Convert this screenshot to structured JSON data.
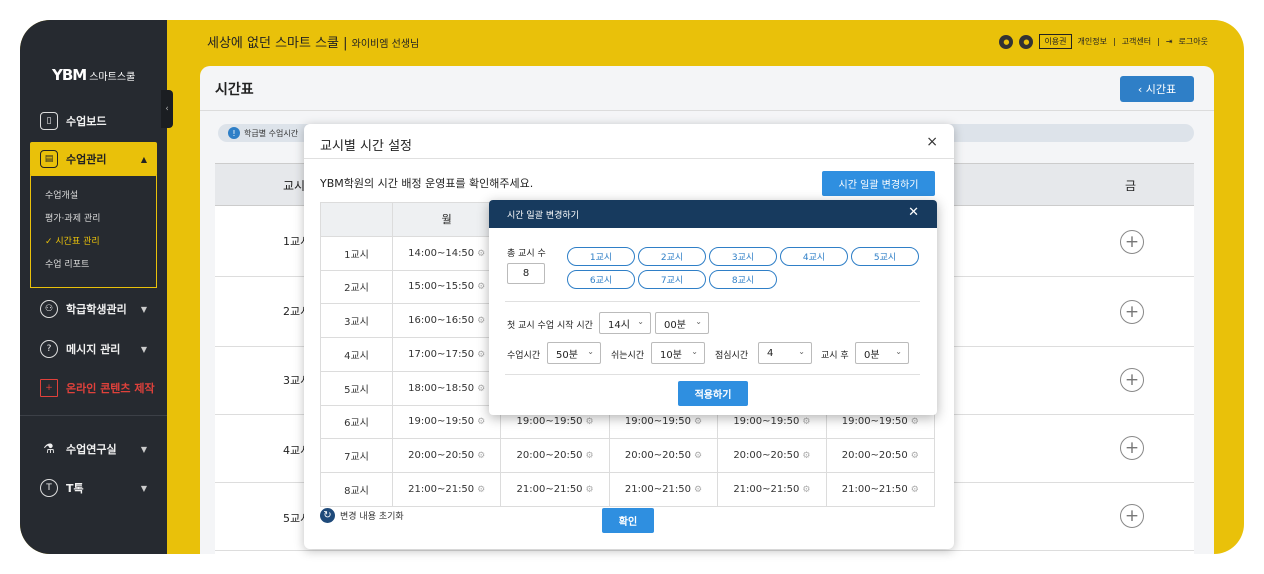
{
  "sidebar": {
    "logo_mark": "YBM",
    "logo_text": "스마트스쿨",
    "items": [
      {
        "label": "수업보드",
        "icon": "book-icon"
      },
      {
        "label": "수업관리",
        "icon": "classroom-icon"
      },
      {
        "label": "학급학생관리",
        "icon": "students-icon"
      },
      {
        "label": "메시지 관리",
        "icon": "message-icon"
      },
      {
        "label": "온라인 콘텐츠 제작",
        "icon": "monitor-icon"
      },
      {
        "label": "수업연구실",
        "icon": "microscope-icon"
      },
      {
        "label": "T톡",
        "icon": "ttalk-icon"
      }
    ],
    "submenu": [
      "수업개설",
      "평가·과제 관리",
      "시간표 관리",
      "수업 리포트"
    ],
    "collapse_glyph": "‹"
  },
  "topbar": {
    "school": "세상에 없던 스마트 스쿨",
    "teacher": "와이비엠 선생님",
    "usage": "이용권",
    "profile": "개인정보",
    "support": "고객센터",
    "logout": "로그아웃",
    "accent": "#e9c10a"
  },
  "page": {
    "title": "시간표",
    "back_label": "시간표",
    "info": "학급별 수업시간",
    "bg_header_period": "교시",
    "bg_header_fri": "금",
    "bg_rows": [
      "1교시",
      "2교시",
      "3교시",
      "4교시",
      "5교시"
    ]
  },
  "modal": {
    "title": "교시별 시간 설정",
    "close": "×",
    "description": "YBM학원의 시간 배정 운영표를 확인해주세요.",
    "bulk_button": "시간 일괄 변경하기",
    "col_mon": "월",
    "periods": [
      "1교시",
      "2교시",
      "3교시",
      "4교시",
      "5교시",
      "6교시",
      "7교시",
      "8교시"
    ],
    "times": [
      "14:00~14:50",
      "15:00~15:50",
      "16:00~16:50",
      "17:00~17:50",
      "18:00~18:50",
      "19:00~19:50",
      "20:00~20:50",
      "21:00~21:50"
    ],
    "reset": "변경 내용 초기화",
    "confirm": "확인",
    "primary_color": "#2f8fe0"
  },
  "popup": {
    "title": "시간 일괄 변경하기",
    "close": "✕",
    "total_label": "총 교시 수",
    "total_value": "8",
    "period_pills": [
      "1교시",
      "2교시",
      "3교시",
      "4교시",
      "5교시",
      "6교시",
      "7교시",
      "8교시"
    ],
    "start_label": "첫 교시 수업 시작 시간",
    "start_hour": "14시",
    "start_min": "00분",
    "class_label": "수업시간",
    "class_value": "50분",
    "break_label": "쉬는시간",
    "break_value": "10분",
    "lunch_label": "점심시간",
    "lunch_after": "4",
    "after_label": "교시 후",
    "lunch_value": "0분",
    "apply": "적용하기",
    "header_color": "#173a5e"
  }
}
